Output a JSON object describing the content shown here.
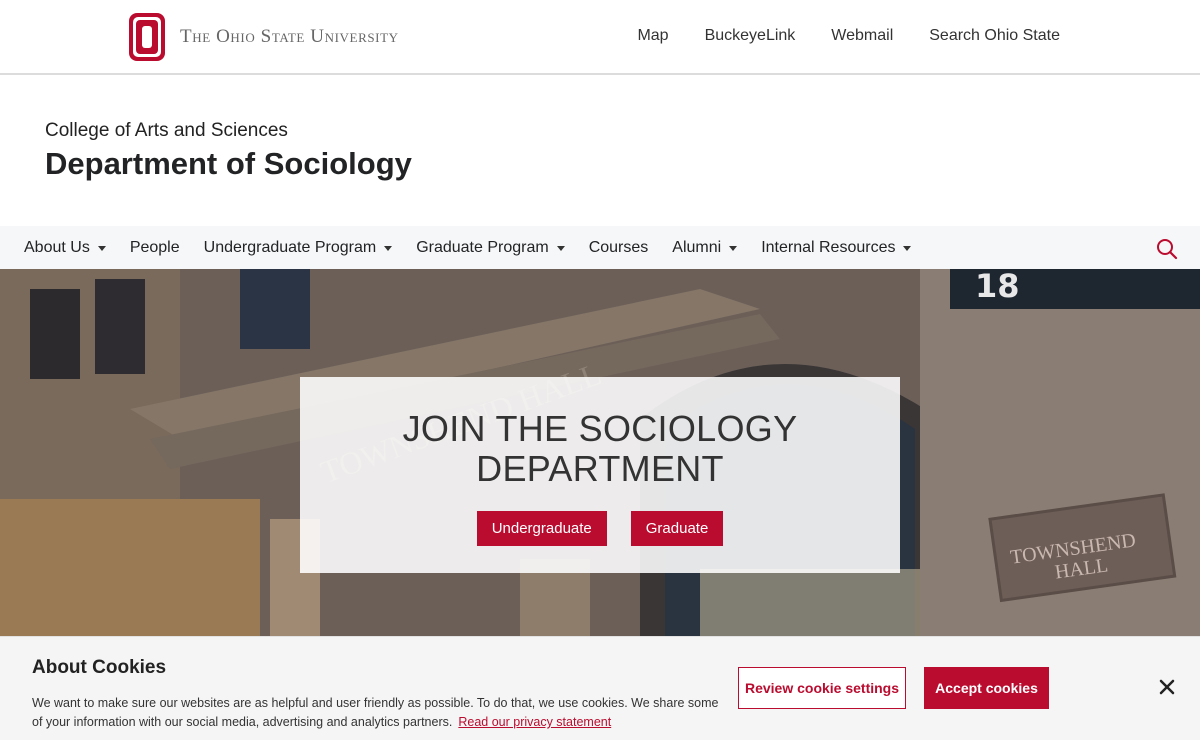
{
  "osu_bar": {
    "wordmark": "The Ohio State University",
    "links": [
      "Map",
      "BuckeyeLink",
      "Webmail",
      "Search Ohio State"
    ]
  },
  "masthead": {
    "college": "College of Arts and Sciences",
    "department": "Department of Sociology"
  },
  "main_nav": {
    "items": [
      {
        "label": "About Us",
        "dropdown": true
      },
      {
        "label": "People",
        "dropdown": false
      },
      {
        "label": "Undergraduate Program",
        "dropdown": true
      },
      {
        "label": "Graduate Program",
        "dropdown": true
      },
      {
        "label": "Courses",
        "dropdown": false
      },
      {
        "label": "Alumni",
        "dropdown": true
      },
      {
        "label": "Internal Resources",
        "dropdown": true
      }
    ],
    "search_icon": "search-icon"
  },
  "hero": {
    "title_line1": "JOIN THE SOCIOLOGY",
    "title_line2": "DEPARTMENT",
    "buttons": [
      "Undergraduate",
      "Graduate"
    ],
    "image_text": {
      "building_number": "18",
      "plaque_line1": "TOWNSHEND",
      "plaque_line2": "HALL",
      "facade_text": "TOWNSHEND HALL"
    }
  },
  "cookie": {
    "title": "About Cookies",
    "text": "We want to make sure our websites are as helpful and user friendly as possible. To do that, we use cookies. We share some of your information with our social media, advertising and analytics partners.",
    "link": "Read our privacy statement",
    "review_button": "Review cookie settings",
    "accept_button": "Accept cookies",
    "close_icon": "close-icon"
  },
  "colors": {
    "scarlet": "#ba0c2f",
    "nav_bg": "#f6f7f8",
    "banner_bg": "#f5f5f5"
  }
}
